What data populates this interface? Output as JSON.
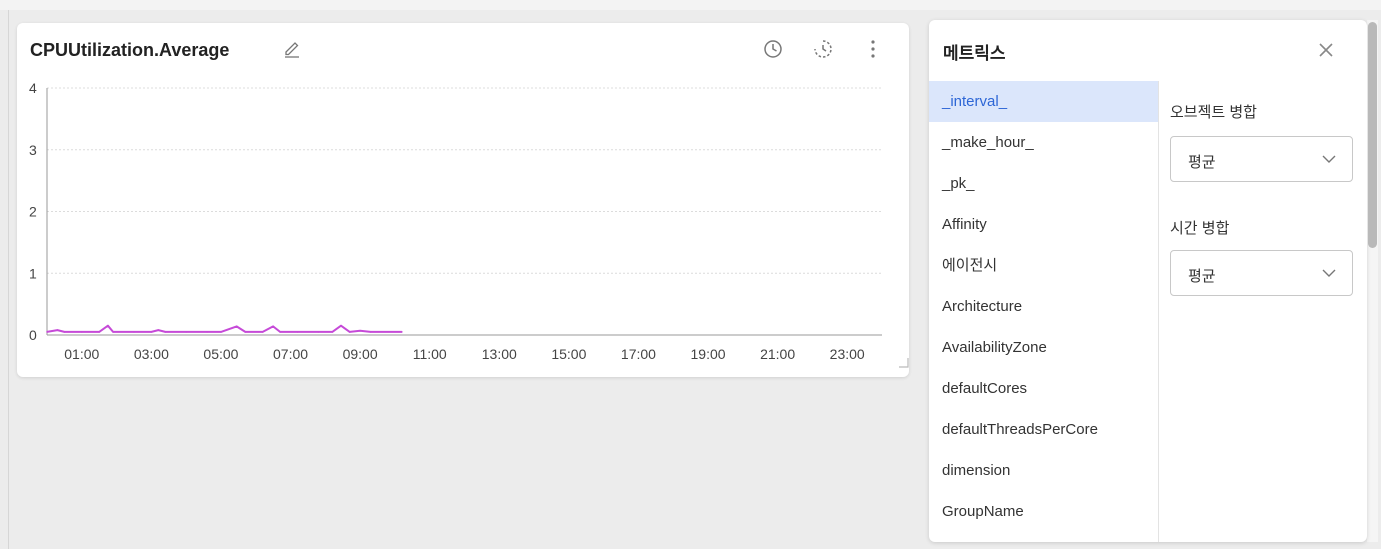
{
  "widget": {
    "title": "CPUUtilization.Average"
  },
  "chart_data": {
    "type": "line",
    "y_ticks": [
      "4",
      "3",
      "2",
      "1",
      "0"
    ],
    "ylim": [
      0,
      4
    ],
    "x_ticks": [
      "01:00",
      "03:00",
      "05:00",
      "07:00",
      "09:00",
      "11:00",
      "13:00",
      "15:00",
      "17:00",
      "19:00",
      "21:00",
      "23:00"
    ],
    "x_range_hours": [
      0,
      24
    ],
    "grid": true,
    "series": [
      {
        "color": "#c64ad8",
        "points": [
          [
            0.0,
            0.05
          ],
          [
            0.3,
            0.08
          ],
          [
            0.5,
            0.05
          ],
          [
            1.0,
            0.05
          ],
          [
            1.5,
            0.05
          ],
          [
            1.75,
            0.15
          ],
          [
            1.9,
            0.05
          ],
          [
            2.5,
            0.05
          ],
          [
            3.0,
            0.05
          ],
          [
            3.2,
            0.08
          ],
          [
            3.4,
            0.05
          ],
          [
            4.0,
            0.05
          ],
          [
            4.6,
            0.05
          ],
          [
            5.0,
            0.05
          ],
          [
            5.45,
            0.14
          ],
          [
            5.7,
            0.05
          ],
          [
            6.2,
            0.05
          ],
          [
            6.5,
            0.14
          ],
          [
            6.7,
            0.05
          ],
          [
            7.2,
            0.05
          ],
          [
            7.8,
            0.05
          ],
          [
            8.2,
            0.05
          ],
          [
            8.45,
            0.15
          ],
          [
            8.7,
            0.05
          ],
          [
            9.0,
            0.07
          ],
          [
            9.3,
            0.05
          ],
          [
            10.2,
            0.05
          ]
        ]
      }
    ]
  },
  "panel": {
    "title": "메트릭스",
    "metrics": [
      "_interval_",
      "_make_hour_",
      "_pk_",
      "Affinity",
      "에이전시",
      "Architecture",
      "AvailabilityZone",
      "defaultCores",
      "defaultThreadsPerCore",
      "dimension",
      "GroupName"
    ],
    "selected_index": 0,
    "object_merge_label": "오브젝트 병합",
    "object_merge_value": "평균",
    "time_merge_label": "시간 병합",
    "time_merge_value": "평균"
  },
  "colors": {
    "accent": "#2d66d6",
    "selected_bg": "#dbe6fb",
    "series": "#c64ad8"
  }
}
